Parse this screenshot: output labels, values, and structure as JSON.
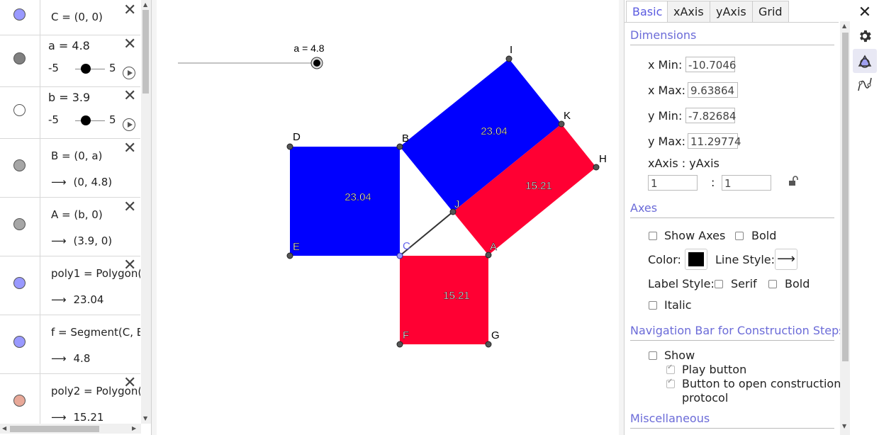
{
  "algebra": {
    "rows": [
      {
        "def": "C = (0, 0)",
        "value": "",
        "color": "#9999ff"
      },
      {
        "def": "a = 4.8",
        "slider_min": "-5",
        "slider_max": "5",
        "slider_value": 4.8,
        "color": "#808080"
      },
      {
        "def": "b = 3.9",
        "slider_min": "-5",
        "slider_max": "5",
        "slider_value": 3.9,
        "color": "#ffffff"
      },
      {
        "def": "B = (0, a)",
        "value": "(0, 4.8)",
        "color": "#a6a6a6"
      },
      {
        "def": "A = (b, 0)",
        "value": "(3.9, 0)",
        "color": "#a6a6a6"
      },
      {
        "def": "poly1 = Polygon(",
        "value": "23.04",
        "color": "#9999ff"
      },
      {
        "def": "f = Segment(C, B",
        "value": "4.8",
        "color": "#9999ff"
      },
      {
        "def": "poly2 = Polygon(",
        "value": "15.21",
        "color": "#e8a898"
      }
    ],
    "arrow": "⟶"
  },
  "graphics": {
    "slider_label": "a = 4.8",
    "slider_fraction": 1.0,
    "points": {
      "I": "I",
      "K": "K",
      "H": "H",
      "D": "D",
      "B": "B",
      "J": "J",
      "E": "E",
      "C": "C",
      "A": "A",
      "F": "F",
      "G": "G"
    },
    "areas": {
      "blue_left": "23.04",
      "blue_right": "23.04",
      "red_right": "15.21",
      "red_bottom": "15.21"
    },
    "colors": {
      "blue": "#0000ff",
      "red": "#ff0033"
    }
  },
  "props": {
    "tabs": [
      "Basic",
      "xAxis",
      "yAxis",
      "Grid"
    ],
    "dimensions_title": "Dimensions",
    "xmin_label": "x Min:",
    "xmin": "-10.7046",
    "xmax_label": "x Max:",
    "xmax": "9.63864",
    "ymin_label": "y Min:",
    "ymin": "-7.82684",
    "ymax_label": "y Max:",
    "ymax": "11.29774",
    "ratio_label": "xAxis : yAxis",
    "ratio_x": "1",
    "ratio_sep": ":",
    "ratio_y": "1",
    "axes_title": "Axes",
    "show_axes": "Show Axes",
    "bold": "Bold",
    "color_label": "Color:",
    "axis_color": "#000000",
    "line_style_label": "Line Style:",
    "line_style_value": "⟶",
    "label_style": "Label Style:",
    "serif": "Serif",
    "bold2": "Bold",
    "italic": "Italic",
    "nav_title": "Navigation Bar for Construction Steps",
    "show": "Show",
    "play_button": "Play button",
    "open_protocol_1": "Button to open construction",
    "open_protocol_2": "protocol",
    "misc_title": "Miscellaneous"
  },
  "toolbar": {
    "close": "✕"
  }
}
